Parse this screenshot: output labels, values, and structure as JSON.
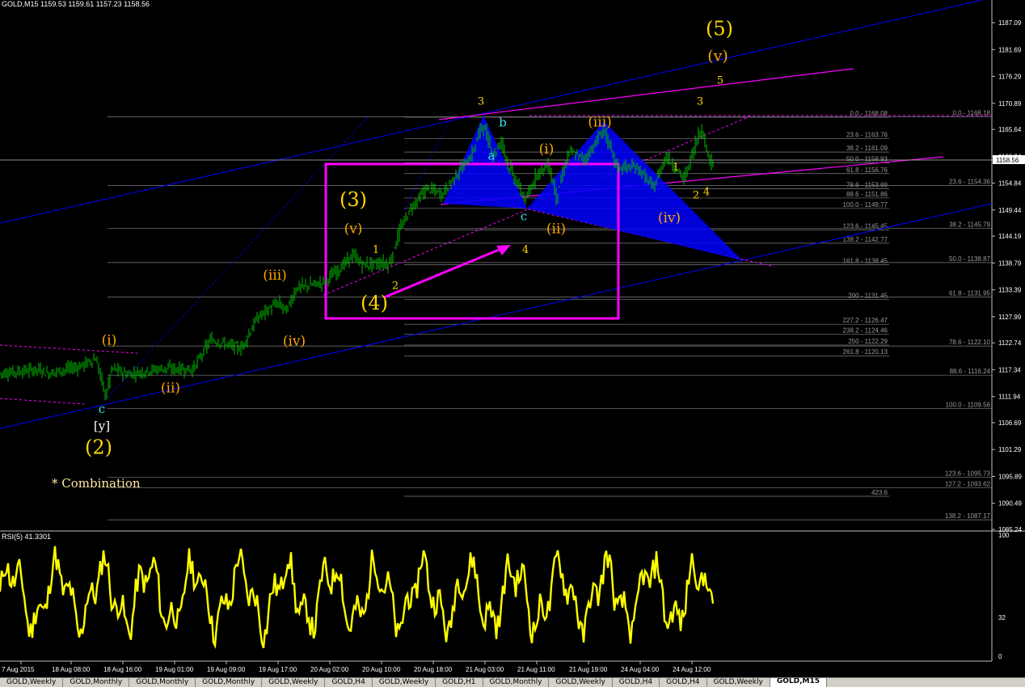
{
  "chart_header": "GOLD,M15  1159.53 1159.61 1157.23 1158.56",
  "rsi_header": "RSI(5) 41.3301",
  "current_price_label": "1158.56",
  "colors": {
    "background": "#000000",
    "candle": "#00c000",
    "rsi": "#ffff00",
    "fib_line": "#808080",
    "channel": "#0000ff",
    "magenta": "#ff00ff",
    "pattern": "#0000ff",
    "wave_orange": "#ffa500",
    "wave_yellow": "#ffd700",
    "wave_cyan": "#40e0f0"
  },
  "chart_data": {
    "type": "candlestick",
    "symbol": "GOLD",
    "timeframe": "M15",
    "open": 1159.53,
    "high": 1159.61,
    "low": 1157.23,
    "close": 1158.56,
    "y_range": [
      1085.24,
      1191.0
    ],
    "y_ticks": [
      "1187.09",
      "1181.69",
      "1176.29",
      "1170.89",
      "1165.64",
      "1160.24",
      "1154.84",
      "1149.44",
      "1144.19",
      "1138.79",
      "1133.39",
      "1127.99",
      "1122.74",
      "1117.34",
      "1111.94",
      "1106.69",
      "1101.29",
      "1095.89",
      "1090.49",
      "1085.24"
    ],
    "x_labels": [
      "7 Aug 2015",
      "18 Aug 08:00",
      "18 Aug 16:00",
      "19 Aug 01:00",
      "19 Aug 09:00",
      "19 Aug 17:00",
      "20 Aug 02:00",
      "20 Aug 10:00",
      "20 Aug 18:00",
      "21 Aug 03:00",
      "21 Aug 11:00",
      "21 Aug 19:00",
      "24 Aug 04:00",
      "24 Aug 12:00"
    ],
    "price_path": [
      {
        "i": 0,
        "p": 1116.6
      },
      {
        "i": 50,
        "p": 1117.4
      },
      {
        "i": 60,
        "p": 1116.6
      },
      {
        "i": 100,
        "p": 1118.0
      },
      {
        "i": 120,
        "p": 1119.6
      },
      {
        "i": 132,
        "p": 1112.0
      },
      {
        "i": 140,
        "p": 1117.6
      },
      {
        "i": 160,
        "p": 1116.4
      },
      {
        "i": 200,
        "p": 1117.6
      },
      {
        "i": 240,
        "p": 1117.4
      },
      {
        "i": 262,
        "p": 1123.4
      },
      {
        "i": 300,
        "p": 1121.6
      },
      {
        "i": 320,
        "p": 1127.8
      },
      {
        "i": 345,
        "p": 1130.8
      },
      {
        "i": 356,
        "p": 1129.2
      },
      {
        "i": 368,
        "p": 1133.8
      },
      {
        "i": 400,
        "p": 1134.8
      },
      {
        "i": 420,
        "p": 1137.4
      },
      {
        "i": 438,
        "p": 1140.4
      },
      {
        "i": 450,
        "p": 1138.4
      },
      {
        "i": 475,
        "p": 1138.8
      },
      {
        "i": 483,
        "p": 1138.4
      },
      {
        "i": 495,
        "p": 1145.0
      },
      {
        "i": 510,
        "p": 1150.0
      },
      {
        "i": 530,
        "p": 1153.8
      },
      {
        "i": 548,
        "p": 1152.6
      },
      {
        "i": 568,
        "p": 1157.0
      },
      {
        "i": 585,
        "p": 1160.4
      },
      {
        "i": 598,
        "p": 1166.8
      },
      {
        "i": 612,
        "p": 1160.4
      },
      {
        "i": 622,
        "p": 1163.4
      },
      {
        "i": 630,
        "p": 1158.4
      },
      {
        "i": 652,
        "p": 1151.2
      },
      {
        "i": 665,
        "p": 1156.8
      },
      {
        "i": 680,
        "p": 1158.4
      },
      {
        "i": 690,
        "p": 1152.0
      },
      {
        "i": 705,
        "p": 1161.2
      },
      {
        "i": 725,
        "p": 1159.6
      },
      {
        "i": 748,
        "p": 1165.6
      },
      {
        "i": 765,
        "p": 1158.0
      },
      {
        "i": 790,
        "p": 1158.0
      },
      {
        "i": 810,
        "p": 1153.8
      },
      {
        "i": 825,
        "p": 1160.4
      },
      {
        "i": 848,
        "p": 1155.6
      },
      {
        "i": 868,
        "p": 1166.0
      },
      {
        "i": 882,
        "p": 1158.56
      }
    ],
    "fibonacci_levels": [
      {
        "label": "0.0 - 1168.08",
        "value": 1168.08
      },
      {
        "label": "23.6 - 1163.76",
        "value": 1163.76
      },
      {
        "label": "38.2 - 1161.09",
        "value": 1161.09
      },
      {
        "label": "50.0 - 1158.93",
        "value": 1158.93
      },
      {
        "label": "61.8 - 1156.76",
        "value": 1156.76
      },
      {
        "label": "78.6 - 1153.69",
        "value": 1153.69
      },
      {
        "label": "88.6 - 1151.86",
        "value": 1151.86
      },
      {
        "label": "100.0 - 1149.77",
        "value": 1149.77
      },
      {
        "label": "123.6 - 1145.45",
        "value": 1145.45
      },
      {
        "label": "138.2 - 1142.77",
        "value": 1142.77
      },
      {
        "label": "161.8 - 1138.45",
        "value": 1138.45
      },
      {
        "label": "200 - 1131.45",
        "value": 1131.45
      },
      {
        "label": "227.2 - 1126.47",
        "value": 1126.47
      },
      {
        "label": "238.2 - 1124.46",
        "value": 1124.46
      },
      {
        "label": "250 - 1122.29",
        "value": 1122.29
      },
      {
        "label": "261.8 - 1120.13",
        "value": 1120.13
      },
      {
        "label": "423.6",
        "value": 1091.9
      }
    ],
    "fibonacci_levels_right": [
      {
        "label": "0.0 - 1168.18",
        "value": 1168.18
      },
      {
        "label": "23.6 - 1154.36",
        "value": 1154.36
      },
      {
        "label": "38.2 - 1145.79",
        "value": 1145.79
      },
      {
        "label": "50.0 - 1138.87",
        "value": 1138.87
      },
      {
        "label": "61.8 - 1131.95",
        "value": 1131.95
      },
      {
        "label": "78.6 - 1122.10",
        "value": 1122.1
      },
      {
        "label": "88.6 - 1116.24",
        "value": 1116.24
      },
      {
        "label": "100.0 - 1109.56",
        "value": 1109.56
      },
      {
        "label": "123.6 - 1095.73",
        "value": 1095.73
      },
      {
        "label": "127.2 - 1093.62",
        "value": 1093.62
      },
      {
        "label": "138.2 - 1087.17",
        "value": 1087.17
      }
    ],
    "wave_labels": [
      {
        "text": "(5)",
        "i": 890,
        "p": 1184.6,
        "color": "wave_yellow",
        "size": 24
      },
      {
        "text": "(v)",
        "i": 888,
        "p": 1179.4,
        "color": "wave_orange",
        "size": 19
      },
      {
        "text": "5",
        "i": 891,
        "p": 1174.8,
        "color": "wave_yellow",
        "size": 13
      },
      {
        "text": "3",
        "i": 595,
        "p": 1170.6,
        "color": "wave_yellow",
        "size": 13
      },
      {
        "text": "b",
        "i": 622,
        "p": 1166.2,
        "color": "wave_cyan",
        "size": 15
      },
      {
        "text": "a",
        "i": 608,
        "p": 1159.6,
        "color": "wave_cyan",
        "size": 15
      },
      {
        "text": "(iii)",
        "i": 742,
        "p": 1166.2,
        "color": "wave_orange",
        "size": 17
      },
      {
        "text": "3",
        "i": 866,
        "p": 1170.6,
        "color": "wave_yellow",
        "size": 13
      },
      {
        "text": "(i)",
        "i": 676,
        "p": 1160.8,
        "color": "wave_orange",
        "size": 17
      },
      {
        "text": "1",
        "i": 836,
        "p": 1157.4,
        "color": "wave_yellow",
        "size": 13
      },
      {
        "text": "(3)",
        "i": 437,
        "p": 1150.2,
        "color": "wave_yellow",
        "size": 24
      },
      {
        "text": "c",
        "i": 648,
        "p": 1147.4,
        "color": "wave_cyan",
        "size": 15
      },
      {
        "text": "(ii)",
        "i": 688,
        "p": 1144.8,
        "color": "wave_orange",
        "size": 17
      },
      {
        "text": "(iv)",
        "i": 828,
        "p": 1147.0,
        "color": "wave_orange",
        "size": 17
      },
      {
        "text": "2",
        "i": 861,
        "p": 1151.8,
        "color": "wave_yellow",
        "size": 13
      },
      {
        "text": "4",
        "i": 874,
        "p": 1152.4,
        "color": "wave_yellow",
        "size": 13
      },
      {
        "text": "(v)",
        "i": 437,
        "p": 1144.8,
        "color": "wave_orange",
        "size": 17
      },
      {
        "text": "1",
        "i": 465,
        "p": 1140.8,
        "color": "wave_yellow",
        "size": 13
      },
      {
        "text": "4",
        "i": 650,
        "p": 1140.8,
        "color": "wave_yellow",
        "size": 13
      },
      {
        "text": "(iii)",
        "i": 340,
        "p": 1135.4,
        "color": "wave_orange",
        "size": 17
      },
      {
        "text": "2",
        "i": 489,
        "p": 1133.6,
        "color": "wave_yellow",
        "size": 13
      },
      {
        "text": "(4)",
        "i": 463,
        "p": 1129.4,
        "color": "wave_yellow",
        "size": 24
      },
      {
        "text": "(iv)",
        "i": 364,
        "p": 1122.2,
        "color": "wave_orange",
        "size": 17
      },
      {
        "text": "(i)",
        "i": 135,
        "p": 1122.4,
        "color": "wave_orange",
        "size": 17
      },
      {
        "text": "(ii)",
        "i": 211,
        "p": 1112.8,
        "color": "wave_orange",
        "size": 17
      },
      {
        "text": "c",
        "i": 126,
        "p": 1108.6,
        "color": "wave_cyan",
        "size": 15
      },
      {
        "text": "[y]",
        "i": 126,
        "p": 1105.2,
        "color": "wave_white",
        "size": 15
      },
      {
        "text": "(2)",
        "i": 122,
        "p": 1100.4,
        "color": "wave_yellow",
        "size": 24
      }
    ],
    "annotation": "* Combination",
    "rsi": {
      "name": "RSI(5)",
      "value": 41.3301,
      "range": [
        0,
        100
      ],
      "ticks": [
        "100",
        "32",
        "0"
      ]
    }
  },
  "tabs": [
    "GOLD,Weekly",
    "GOLD,Monthly",
    "GOLD,Monthly",
    "GOLD,Monthly",
    "GOLD,Weekly",
    "GOLD,H4",
    "GOLD,Weekly",
    "GOLD,H1",
    "GOLD,Monthly",
    "GOLD,Weekly",
    "GOLD,H4",
    "GOLD,H4",
    "GOLD,Weekly",
    "GOLD,M15"
  ]
}
